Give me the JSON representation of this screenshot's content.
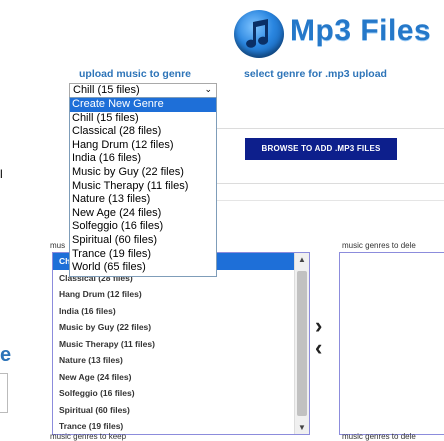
{
  "header": {
    "logo_text": "Mp3 Files",
    "logo_icon": "music-note-icon"
  },
  "captions": {
    "upload": "upload music to genre",
    "select": "select genre for .mp3 upload"
  },
  "genre_select": {
    "value": "Chill (15 files)",
    "options": [
      "Create New Genre",
      "Chill (15 files)",
      "Classical (28 files)",
      "Hang Drum (12 files)",
      "India (16 files)",
      "Music by Guy (22 files)",
      "Music Therapy (11 files)",
      "Nature (13 files)",
      "New Age (24 files)",
      "Solfeggio (16 files)",
      "Spiritual (60 files)",
      "Trance (19 files)",
      "World (65 files)"
    ],
    "highlighted": "Create New Genre"
  },
  "browse_button": "BROWSE TO ADD .MP3 FILES",
  "edge_fragments": {
    "glyph": "l",
    "letter": "e"
  },
  "keep": {
    "label": "mus",
    "footer": "music genres to keep",
    "items": [
      "Ch",
      "Classical (28 files)",
      "Hang Drum (12 files)",
      "India (16 files)",
      "Music by Guy (22 files)",
      "Music Therapy (11 files)",
      "Nature (13 files)",
      "New Age (24 files)",
      "Solfeggio (16 files)",
      "Spiritual (60 files)",
      "Trance (19 files)"
    ],
    "selected_index": 0
  },
  "move_icons": {
    "right": "chevron-right-icon",
    "left": "chevron-left-icon"
  },
  "delete": {
    "label": "music genres to dele",
    "footer": "music genres to dele",
    "items": []
  },
  "colors": {
    "accent": "#2578c9",
    "button": "#0d1f8c",
    "selection": "#1e6fd8"
  }
}
